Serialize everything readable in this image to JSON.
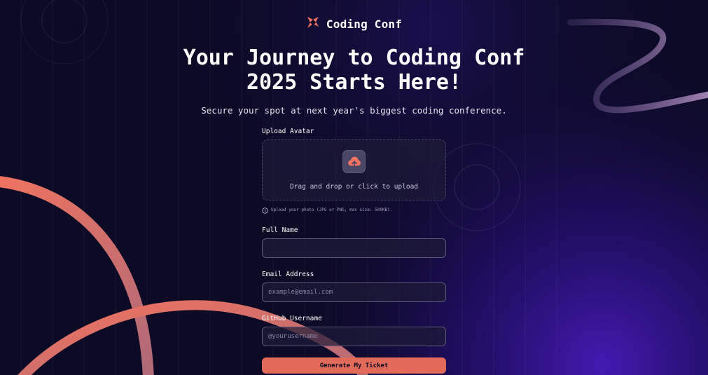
{
  "brand": {
    "name": "Coding Conf",
    "icon": "coding-conf-logo-icon"
  },
  "hero": {
    "title_line1": "Your Journey to Coding Conf",
    "title_line2": "2025 Starts Here!",
    "subtitle": "Secure your spot at next year's biggest coding conference."
  },
  "form": {
    "avatar": {
      "label": "Upload Avatar",
      "dropzone_text": "Drag and drop or click to upload",
      "hint": "Upload your photo (JPG or PNG, max size: 500KB).",
      "icon": "cloud-upload-icon"
    },
    "full_name": {
      "label": "Full Name",
      "value": "",
      "placeholder": ""
    },
    "email": {
      "label": "Email Address",
      "value": "",
      "placeholder": "example@email.com"
    },
    "github": {
      "label": "GitHub Username",
      "value": "",
      "placeholder": "@yourusername"
    },
    "submit_label": "Generate My Ticket"
  },
  "colors": {
    "background": "#0c0a24",
    "accent": "#e16a58",
    "gradient_purple": "#3a12a8"
  }
}
